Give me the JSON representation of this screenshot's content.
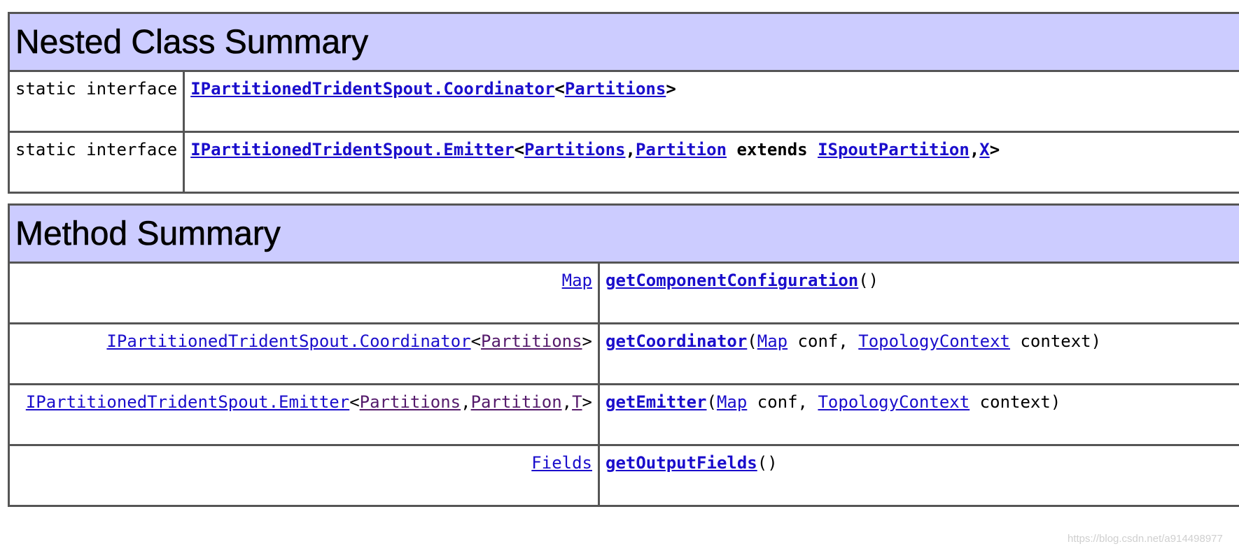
{
  "nested": {
    "title": "Nested Class Summary",
    "rows": [
      {
        "modifier": "static interface",
        "link": "IPartitionedTridentSpout.Coordinator",
        "lt": "<",
        "param1": "Partitions",
        "gt": ">"
      },
      {
        "modifier": "static interface",
        "link": "IPartitionedTridentSpout.Emitter",
        "lt": "<",
        "param1": "Partitions",
        "comma1": ",",
        "param2": "Partition",
        "extends": " extends ",
        "param3": "ISpoutPartition",
        "comma2": ",",
        "param4": "X",
        "gt": ">"
      }
    ]
  },
  "method": {
    "title": "Method Summary",
    "rows": [
      {
        "type": "Map",
        "name": "getComponentConfiguration",
        "args": "()"
      },
      {
        "type_link": "IPartitionedTridentSpout.Coordinator",
        "type_lt": "<",
        "type_p1": "Partitions",
        "type_gt": ">",
        "name": "getCoordinator",
        "open": "(",
        "a1_type": "Map",
        "a1_name": " conf, ",
        "a2_type": "TopologyContext",
        "a2_name": " context)"
      },
      {
        "type_link": "IPartitionedTridentSpout.Emitter",
        "type_lt": "<",
        "type_p1": "Partitions",
        "type_c1": ",",
        "type_p2": "Partition",
        "type_c2": ",",
        "type_p3": "T",
        "type_gt": ">",
        "name": "getEmitter",
        "open": "(",
        "a1_type": "Map",
        "a1_name": " conf, ",
        "a2_type": "TopologyContext",
        "a2_name": " context)"
      },
      {
        "type": "Fields",
        "name": "getOutputFields",
        "args": "()"
      }
    ]
  },
  "watermark": "https://blog.csdn.net/a914498977"
}
